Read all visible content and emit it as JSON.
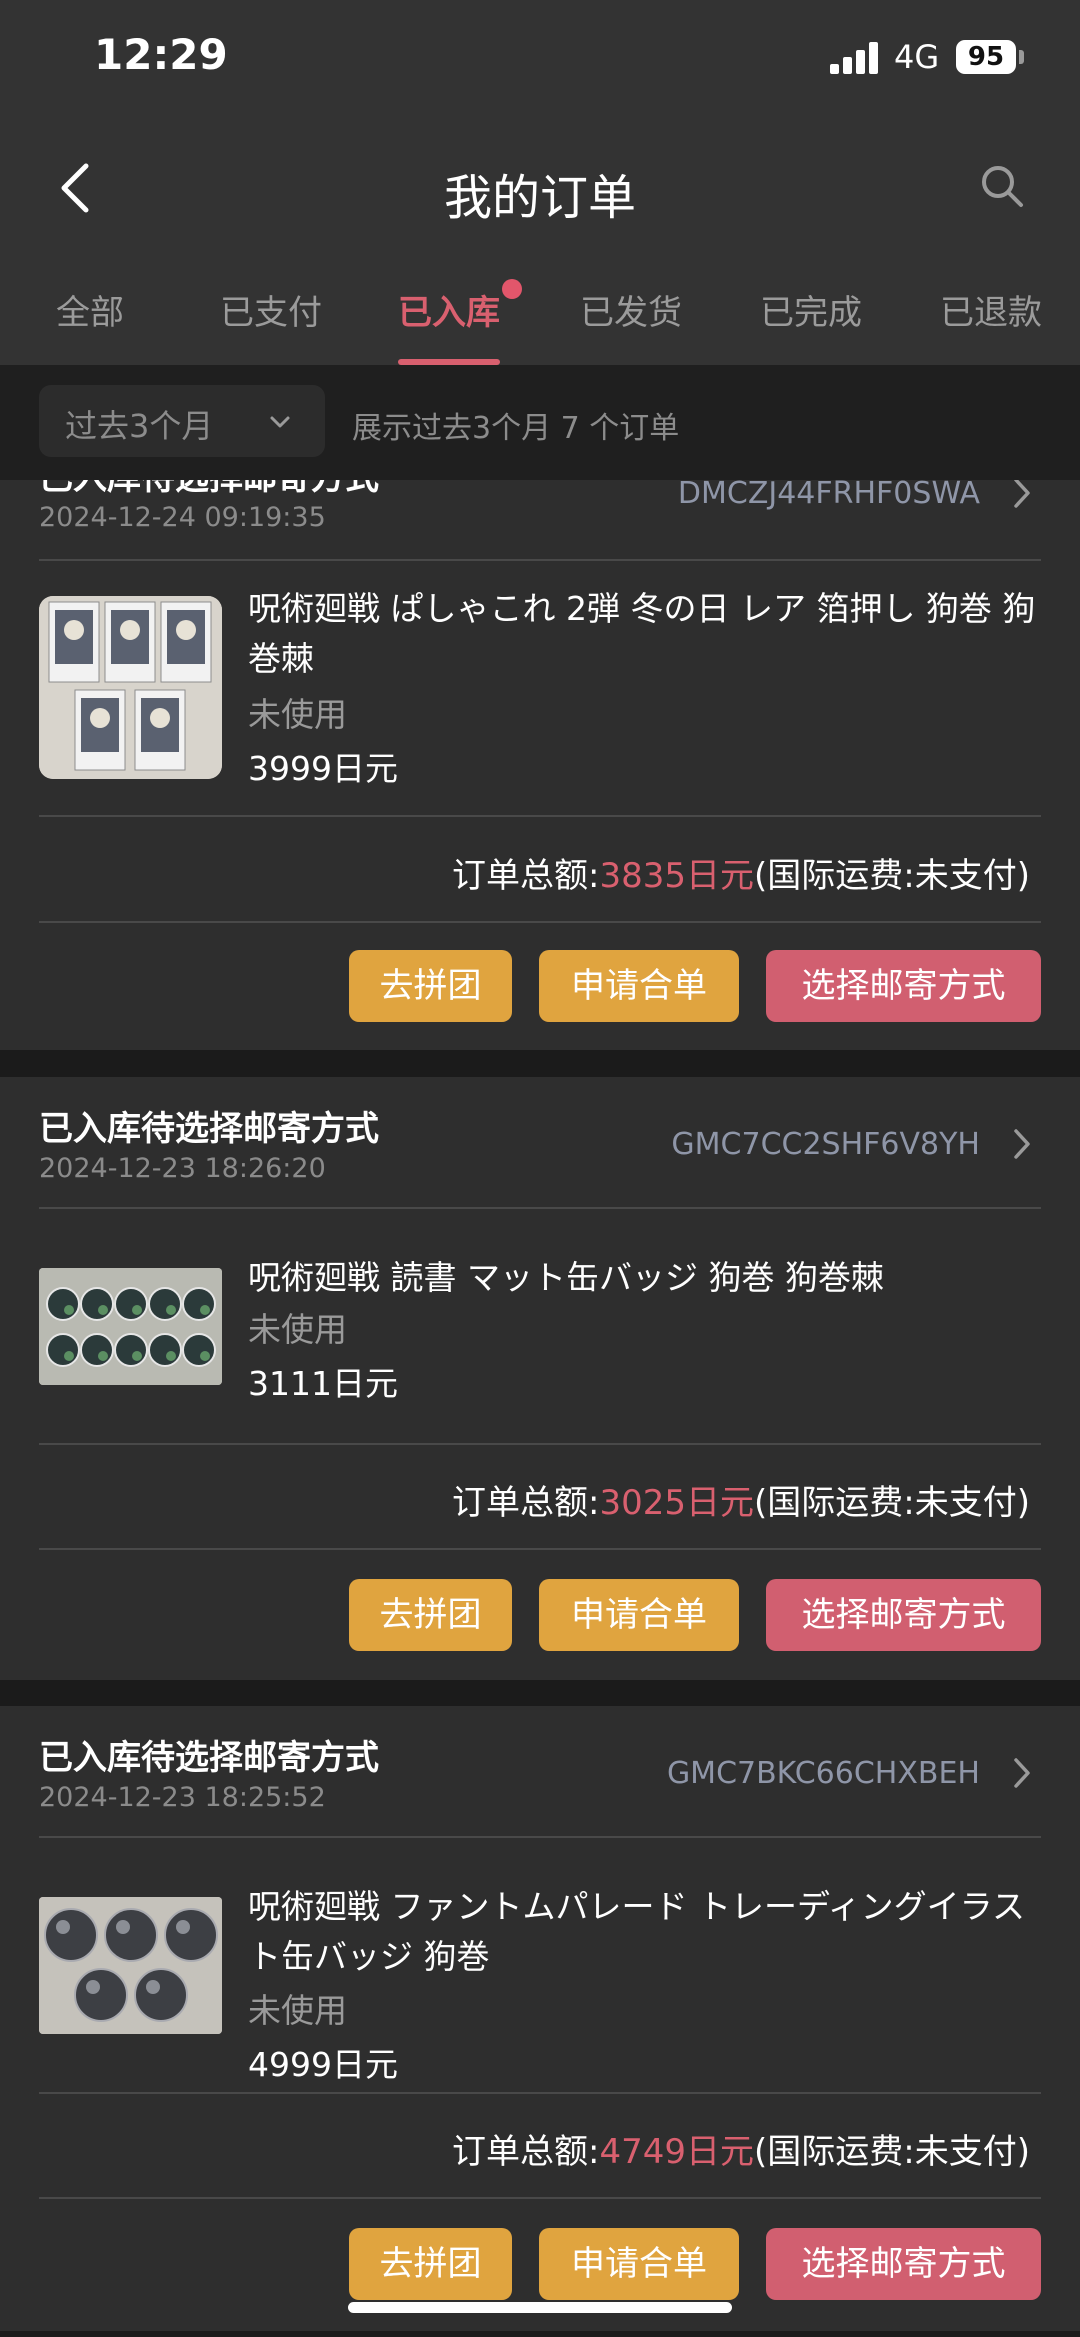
{
  "status_bar": {
    "time": "12:29",
    "network": "4G",
    "battery": "95"
  },
  "nav": {
    "title": "我的订单"
  },
  "tabs": [
    {
      "label": "全部"
    },
    {
      "label": "已支付"
    },
    {
      "label": "已入库"
    },
    {
      "label": "已发货"
    },
    {
      "label": "已完成"
    },
    {
      "label": "已退款"
    }
  ],
  "filter": {
    "period": "过去3个月",
    "summary": "展示过去3个月 7 个订单"
  },
  "orders": [
    {
      "status": "已入库待选择邮寄方式",
      "date": "2024-12-24 09:19:35",
      "order_id": "DMCZJ44FRHF0SWA",
      "product_title": "呪術廻戦 ぱしゃこれ 2弾 冬の日 レア 箔押し 狗巻 狗巻棘",
      "condition": "未使用",
      "price": "3999日元",
      "total_label": "订单总额:",
      "total_amount": "3835日元",
      "shipping_note": "(国际运费:未支付)",
      "btn_group": "去拼团",
      "btn_merge": "申请合单",
      "btn_shipping": "选择邮寄方式"
    },
    {
      "status": "已入库待选择邮寄方式",
      "date": "2024-12-23 18:26:20",
      "order_id": "GMC7CC2SHF6V8YH",
      "product_title": "呪術廻戦 読書 マット缶バッジ 狗巻 狗巻棘",
      "condition": "未使用",
      "price": "3111日元",
      "total_label": "订单总额:",
      "total_amount": "3025日元",
      "shipping_note": "(国际运费:未支付)",
      "btn_group": "去拼团",
      "btn_merge": "申请合单",
      "btn_shipping": "选择邮寄方式"
    },
    {
      "status": "已入库待选择邮寄方式",
      "date": "2024-12-23 18:25:52",
      "order_id": "GMC7BKC66CHXBEH",
      "product_title": "呪術廻戦 ファントムパレード トレーディングイラスト缶バッジ 狗巻",
      "condition": "未使用",
      "price": "4999日元",
      "total_label": "订单总额:",
      "total_amount": "4749日元",
      "shipping_note": "(国际运费:未支付)",
      "btn_group": "去拼团",
      "btn_merge": "申请合单",
      "btn_shipping": "选择邮寄方式"
    }
  ],
  "colors": {
    "accent": "#d9606f",
    "button_yellow": "#e0a43f",
    "button_pink": "#d15f70",
    "card_bg": "#2e2e2e"
  }
}
